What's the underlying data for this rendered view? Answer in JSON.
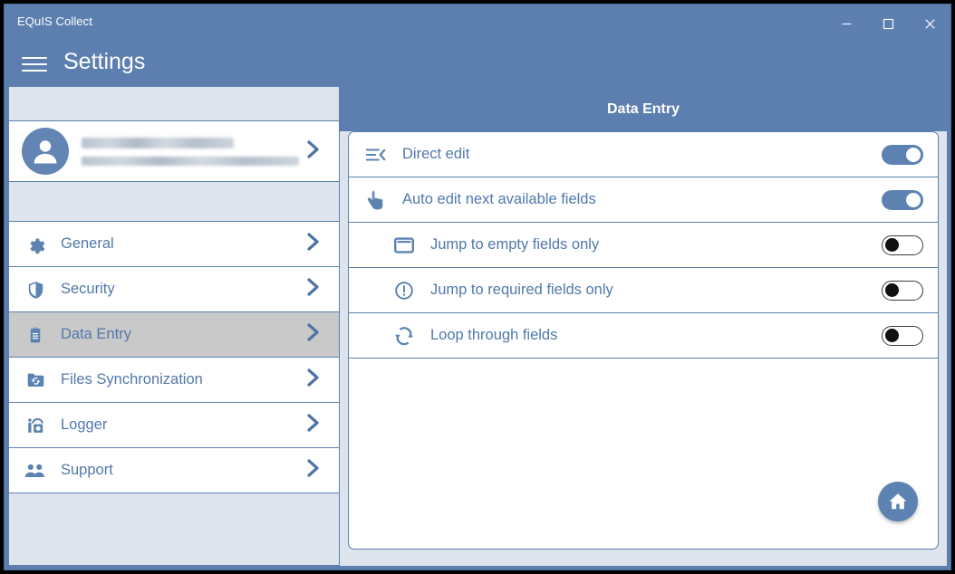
{
  "window": {
    "title": "EQuIS Collect",
    "controls": [
      {
        "name": "minimize",
        "glyph": "–"
      },
      {
        "name": "maximize",
        "glyph": "□"
      },
      {
        "name": "close",
        "glyph": "✕"
      }
    ]
  },
  "header": {
    "menu_icon": "hamburger-icon",
    "title": "Settings"
  },
  "sidebar": {
    "profile": {
      "avatar_icon": "user-avatar-icon",
      "name": "",
      "email": "",
      "chevron": "›"
    },
    "items": [
      {
        "label": "General",
        "icon": "gear-icon",
        "selected": false,
        "chevron": "›"
      },
      {
        "label": "Security",
        "icon": "shield-icon",
        "selected": false,
        "chevron": "›"
      },
      {
        "label": "Data Entry",
        "icon": "clipboard-icon",
        "selected": true,
        "chevron": "›"
      },
      {
        "label": "Files Synchronization",
        "icon": "folder-sync-icon",
        "selected": false,
        "chevron": "›"
      },
      {
        "label": "Logger",
        "icon": "logger-icon",
        "selected": false,
        "chevron": "›"
      },
      {
        "label": "Support",
        "icon": "people-icon",
        "selected": false,
        "chevron": "›"
      }
    ]
  },
  "content": {
    "title": "Data Entry",
    "settings": [
      {
        "label": "Direct edit",
        "icon": "list-collapse-icon",
        "state": "on",
        "sub": false
      },
      {
        "label": "Auto edit next available fields",
        "icon": "tap-hand-icon",
        "state": "on",
        "sub": false
      },
      {
        "label": "Jump to empty fields only",
        "icon": "empty-field-icon",
        "state": "off",
        "sub": true
      },
      {
        "label": "Jump to required fields only",
        "icon": "exclamation-circle-icon",
        "state": "off",
        "sub": true
      },
      {
        "label": "Loop through fields",
        "icon": "loop-refresh-icon",
        "state": "off",
        "sub": true
      }
    ],
    "home_button_icon": "home-icon"
  },
  "colors": {
    "chrome_blue": "#5c7fb0",
    "accent": "#5c82b1",
    "panel_bg": "#dee4ec",
    "text_blue": "#5178ac",
    "selected_row": "#c9c9c9"
  }
}
